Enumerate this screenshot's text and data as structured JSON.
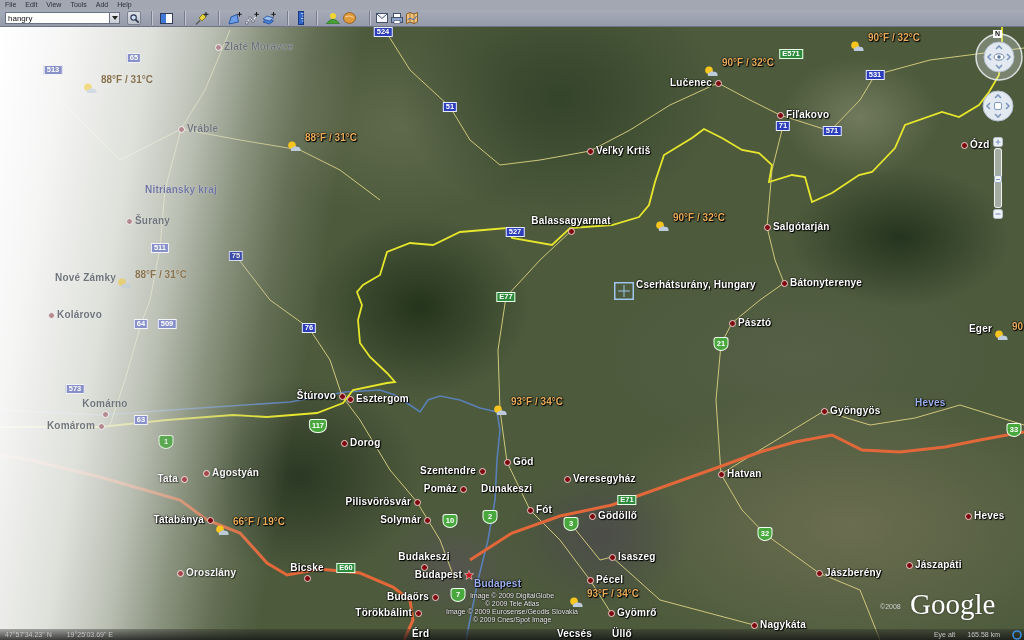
{
  "menu": [
    "File",
    "Edit",
    "View",
    "Tools",
    "Add",
    "Help"
  ],
  "toolbar": {
    "search": {
      "value": "hangry"
    }
  },
  "map": {
    "places": [
      {
        "name": "Zlaté Moravce",
        "kind": "town"
      },
      {
        "name": "Lučenec",
        "kind": "town"
      },
      {
        "name": "Fiľakovo",
        "kind": "town"
      },
      {
        "name": "Vráble",
        "kind": "town"
      },
      {
        "name": "Veľký Krtiš",
        "kind": "town"
      },
      {
        "name": "Ózd",
        "kind": "town"
      },
      {
        "name": "Šurany",
        "kind": "town"
      },
      {
        "name": "Balassagyarmat",
        "kind": "town"
      },
      {
        "name": "Salgótarján",
        "kind": "town"
      },
      {
        "name": "Nové Zámky",
        "kind": "label"
      },
      {
        "name": "Bátonyterenye",
        "kind": "town"
      },
      {
        "name": "Kolárovo",
        "kind": "town"
      },
      {
        "name": "Pásztó",
        "kind": "town"
      },
      {
        "name": "Eger",
        "kind": "label"
      },
      {
        "name": "Komárno",
        "kind": "town"
      },
      {
        "name": "Štúrovo",
        "kind": "town"
      },
      {
        "name": "Esztergom",
        "kind": "town"
      },
      {
        "name": "Gyöngyös",
        "kind": "town"
      },
      {
        "name": "Komárom",
        "kind": "town"
      },
      {
        "name": "Dorog",
        "kind": "town"
      },
      {
        "name": "Göd",
        "kind": "town"
      },
      {
        "name": "Tata",
        "kind": "town"
      },
      {
        "name": "Agostyán",
        "kind": "town"
      },
      {
        "name": "Szentendre",
        "kind": "town"
      },
      {
        "name": "Veresegyház",
        "kind": "town"
      },
      {
        "name": "Hatvan",
        "kind": "town"
      },
      {
        "name": "Pomáz",
        "kind": "town"
      },
      {
        "name": "Dunakeszi",
        "kind": "label"
      },
      {
        "name": "Pilisvörösvár",
        "kind": "town"
      },
      {
        "name": "Tatabánya",
        "kind": "town"
      },
      {
        "name": "Solymár",
        "kind": "town"
      },
      {
        "name": "Fót",
        "kind": "town"
      },
      {
        "name": "Gödöllő",
        "kind": "town"
      },
      {
        "name": "Heves",
        "kind": "town"
      },
      {
        "name": "Budakeszi",
        "kind": "town"
      },
      {
        "name": "Isaszeg",
        "kind": "town"
      },
      {
        "name": "Oroszlány",
        "kind": "town"
      },
      {
        "name": "Bicske",
        "kind": "town"
      },
      {
        "name": "Pécel",
        "kind": "town"
      },
      {
        "name": "Jászberény",
        "kind": "town"
      },
      {
        "name": "Jászapáti",
        "kind": "town"
      },
      {
        "name": "Budaörs",
        "kind": "town"
      },
      {
        "name": "Törökbálint",
        "kind": "town"
      },
      {
        "name": "Gyömrő",
        "kind": "town"
      },
      {
        "name": "Érd",
        "kind": "label"
      },
      {
        "name": "Vecsés",
        "kind": "label"
      },
      {
        "name": "Üllő",
        "kind": "label"
      },
      {
        "name": "Nagykáta",
        "kind": "town"
      }
    ],
    "capital": {
      "name": "Budapest"
    },
    "regions": [
      {
        "name": "Nitriansky kraj"
      },
      {
        "name": "Heves"
      },
      {
        "name": "Budapest"
      }
    ],
    "weather": [
      {
        "reading": "90°F / 32°C"
      },
      {
        "reading": "90°F / 32°C"
      },
      {
        "reading": "88°F / 31°C"
      },
      {
        "reading": "88°F / 31°C"
      },
      {
        "reading": "90°F / 32°C"
      },
      {
        "reading": "88°F / 31°C"
      },
      {
        "reading": "90"
      },
      {
        "reading": "93°F / 34°C"
      },
      {
        "reading": "66°F / 19°C"
      },
      {
        "reading": "93°F / 34°C"
      }
    ],
    "routes": [
      {
        "number": "524",
        "kind": "plate"
      },
      {
        "number": "65",
        "kind": "plate"
      },
      {
        "number": "E571",
        "kind": "euro"
      },
      {
        "number": "513",
        "kind": "plate"
      },
      {
        "number": "531",
        "kind": "plate"
      },
      {
        "number": "51",
        "kind": "plate"
      },
      {
        "number": "71",
        "kind": "plate"
      },
      {
        "number": "571",
        "kind": "plate"
      },
      {
        "number": "527",
        "kind": "plate"
      },
      {
        "number": "511",
        "kind": "plate"
      },
      {
        "number": "75",
        "kind": "plate"
      },
      {
        "number": "E77",
        "kind": "euro"
      },
      {
        "number": "64",
        "kind": "plate"
      },
      {
        "number": "509",
        "kind": "plate"
      },
      {
        "number": "76",
        "kind": "plate"
      },
      {
        "number": "21",
        "kind": "shield"
      },
      {
        "number": "573",
        "kind": "plate"
      },
      {
        "number": "63",
        "kind": "plate"
      },
      {
        "number": "117",
        "kind": "shield"
      },
      {
        "number": "1",
        "kind": "shield"
      },
      {
        "number": "33",
        "kind": "shield"
      },
      {
        "number": "E71",
        "kind": "euro"
      },
      {
        "number": "10",
        "kind": "shield"
      },
      {
        "number": "2",
        "kind": "shield"
      },
      {
        "number": "3",
        "kind": "shield"
      },
      {
        "number": "32",
        "kind": "shield"
      },
      {
        "number": "E60",
        "kind": "euro"
      },
      {
        "number": "7",
        "kind": "shield"
      }
    ],
    "search_result": {
      "label": "Cserhátsurány, Hungary"
    },
    "attribution": [
      "Image © 2009 DigitalGlobe",
      "© 2009 Tele Atlas",
      "Image © 2009 Eurosense/Geodis Slovakia",
      "© 2009 Cnes/Spot Image"
    ],
    "copyright": "©2008",
    "logo": "Google"
  },
  "navigation": {
    "north": "N",
    "zoom": {
      "level": 0.5
    }
  },
  "status_bar": {
    "latitude": "47°57'34.23\" N",
    "longitude": "19°25'03.69\" E",
    "eye_alt_label": "Eye alt",
    "eye_alt_value": "165.58 km"
  }
}
